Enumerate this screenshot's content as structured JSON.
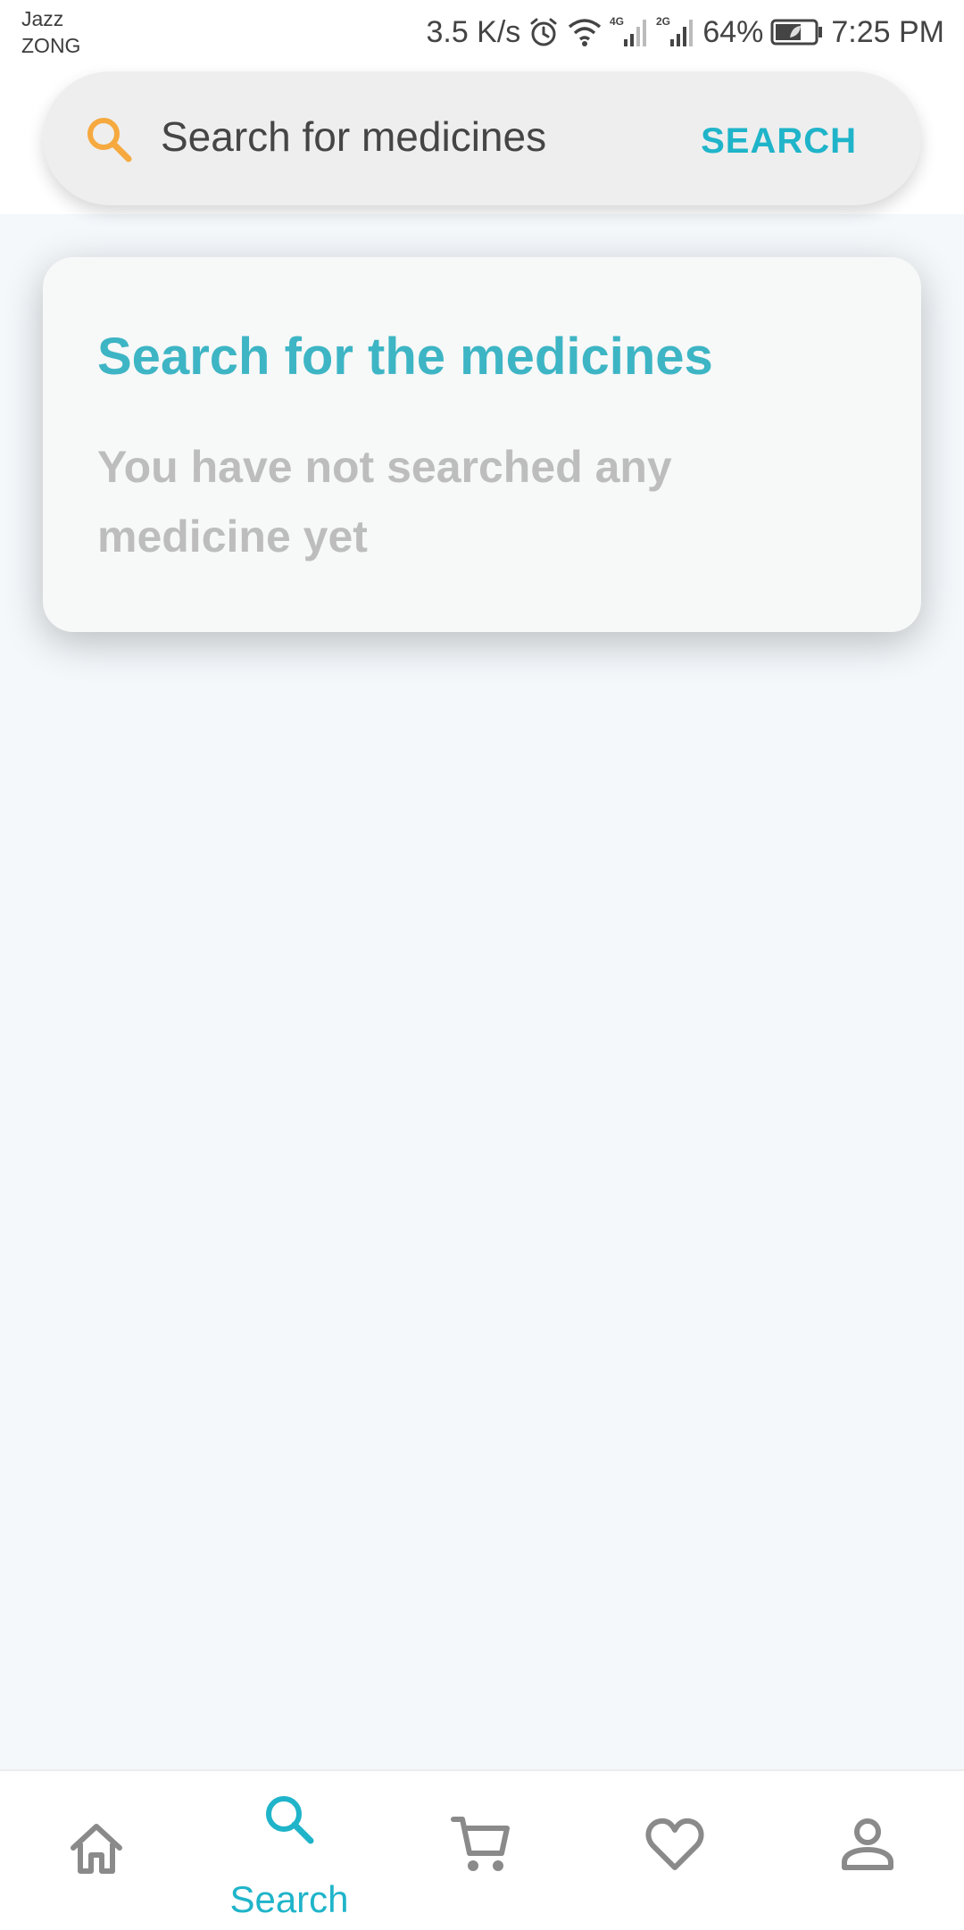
{
  "status_bar": {
    "carrier_1": "Jazz",
    "carrier_2": "ZONG",
    "network_speed": "3.5 K/s",
    "battery_percent": "64%",
    "time": "7:25 PM",
    "icons": [
      "alarm-icon",
      "wifi-icon",
      "4g-signal-icon",
      "2g-signal-icon",
      "battery-icon"
    ]
  },
  "search": {
    "placeholder": "Search for medicines",
    "value": "",
    "button_label": "SEARCH",
    "icon": "search-icon"
  },
  "empty_state": {
    "title": "Search for the medicines",
    "message": "You have not searched any medicine yet"
  },
  "bottom_nav": {
    "active": "search",
    "items": [
      {
        "id": "home",
        "icon": "home-icon",
        "label": ""
      },
      {
        "id": "search",
        "icon": "search-icon",
        "label": "Search"
      },
      {
        "id": "cart",
        "icon": "cart-icon",
        "label": ""
      },
      {
        "id": "favorites",
        "icon": "heart-icon",
        "label": ""
      },
      {
        "id": "profile",
        "icon": "person-icon",
        "label": ""
      }
    ]
  },
  "colors": {
    "accent": "#1fb4c9",
    "title": "#3db5c4",
    "search_icon": "#f5a93f",
    "muted_text": "#bdbdbd",
    "inactive_icon": "#8a8a8a",
    "background": "#f4f8fb"
  }
}
